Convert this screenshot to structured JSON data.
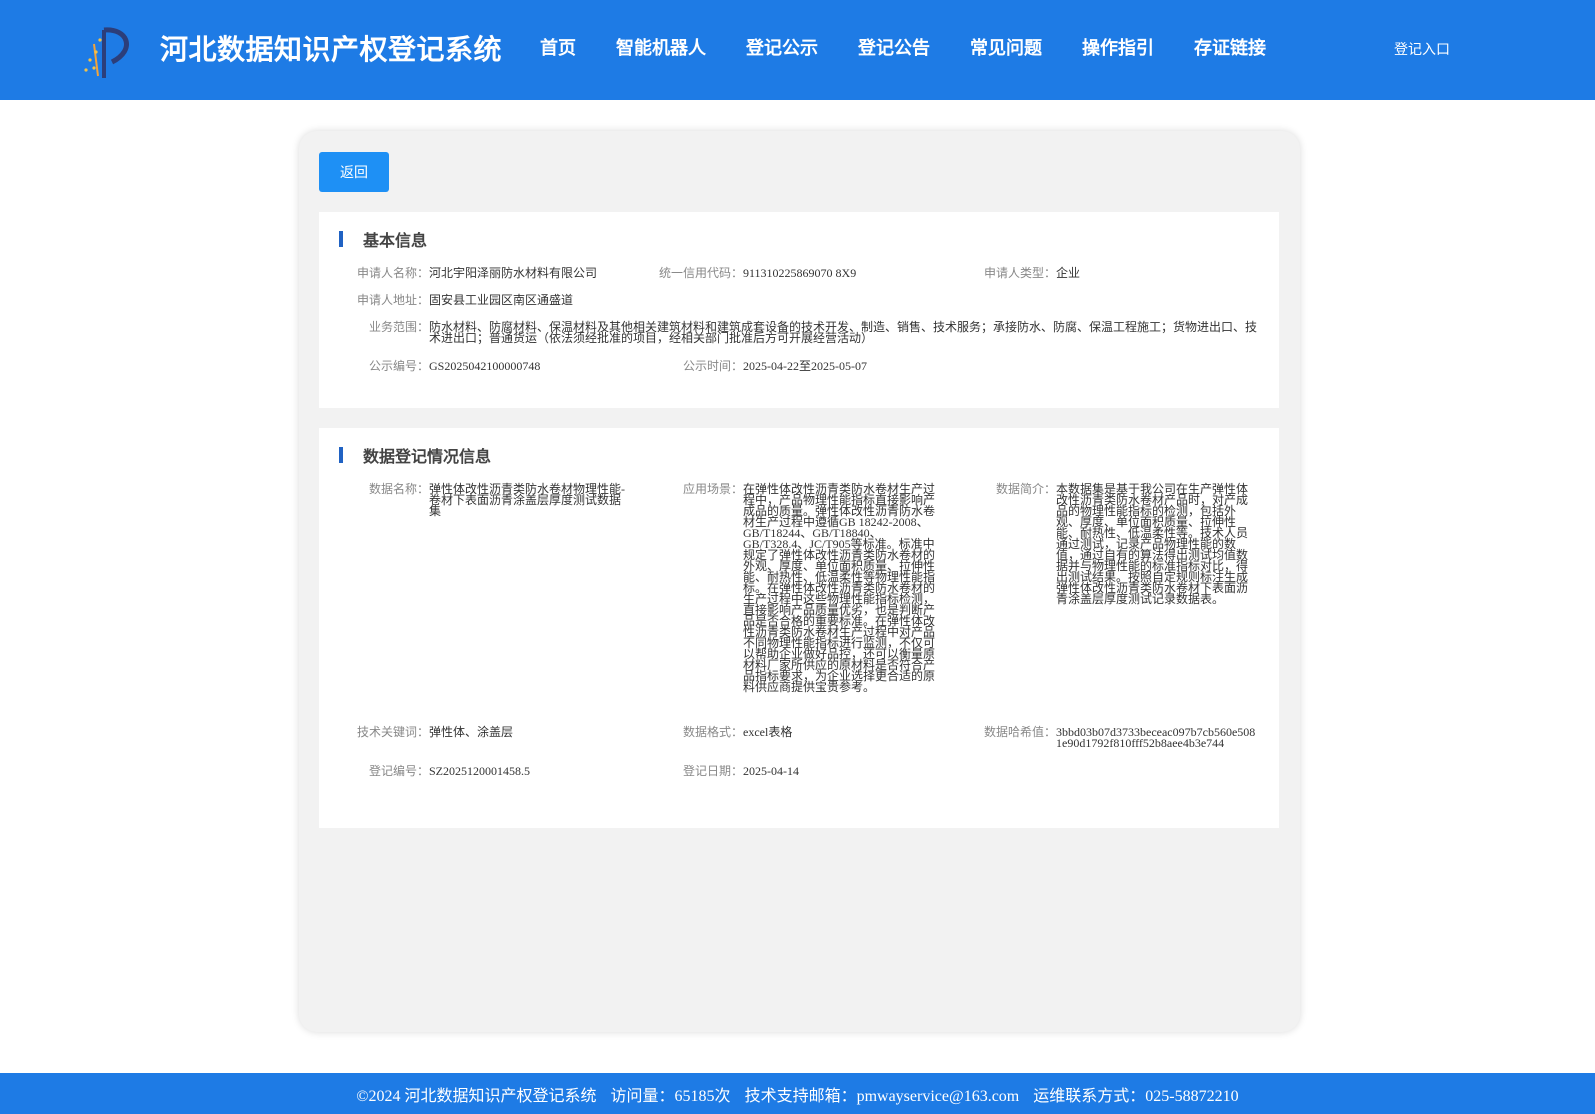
{
  "header": {
    "site_title": "河北数据知识产权登记系统",
    "nav": [
      "首页",
      "智能机器人",
      "登记公示",
      "登记公告",
      "常见问题",
      "操作指引",
      "存证链接"
    ],
    "login": "登记入口",
    "colors": {
      "bar": "#1e7be5",
      "accent": "#1e90f5"
    }
  },
  "back_button": "返回",
  "basic_info": {
    "title": "基本信息",
    "applicant_name": {
      "label": "申请人名称：",
      "value": "河北宇阳泽丽防水材料有限公司"
    },
    "credit_code": {
      "label": "统一信用代码：",
      "value": "911310225869070 8X9"
    },
    "applicant_type": {
      "label": "申请人类型：",
      "value": "企业"
    },
    "address": {
      "label": "申请人地址：",
      "value": "固安县工业园区南区通盛道"
    },
    "business_scope": {
      "label": "业务范围：",
      "value": "防水材料、防腐材料、保温材料及其他相关建筑材料和建筑成套设备的技术开发、制造、销售、技术服务；承接防水、防腐、保温工程施工；货物进出口、技术进出口；普通货运（依法须经批准的项目，经相关部门批准后方可开展经营活动）"
    },
    "notice_no": {
      "label": "公示编号：",
      "value": "GS2025042100000748"
    },
    "notice_time": {
      "label": "公示时间：",
      "value": "2025-04-22至2025-05-07"
    }
  },
  "registration_info": {
    "title": "数据登记情况信息",
    "data_name": {
      "label": "数据名称：",
      "value": "弹性体改性沥青类防水卷材物理性能-卷材下表面沥青涂盖层厚度测试数据集"
    },
    "scenario": {
      "label": "应用场景：",
      "value": "在弹性体改性沥青类防水卷材生产过程中，产品物理性能指标直接影响产成品的质量。弹性体改性沥青防水卷材生产过程中遵循GB 18242-2008、GB/T18244、GB/T18840、GB/T328.4、JC/T905等标准。标准中规定了弹性体改性沥青类防水卷材的外观、厚度、单位面积质量、拉伸性能、耐热性、低温柔性等物理性能指标。在弹性体改性沥青类防水卷材的生产过程中这些物理性能指标检测，直接影响产品质量优劣，也是判断产品是否合格的重要标准。在弹性体改性沥青类防水卷材生产过程中对产品不同物理性能指标进行监测，不仅可以帮助企业做好品控，还可以衡量原材料厂家所供应的原材料是否符合产品指标要求，为企业选择更合适的原料供应商提供宝贵参考。"
    },
    "intro": {
      "label": "数据简介：",
      "value": "本数据集是基于我公司在生产弹性体改性沥青类防水卷材产品时，对产成品的物理性能指标的检测，包括外观、厚度、单位面积质量、拉伸性能、耐热性、低温柔性等。技术人员通过测试，记录产品物理性能的数值，通过自有的算法得出测试均值数据并与物理性能的标准指标对比，得出测试结果。按照自定规则标注生成弹性体改性沥青类防水卷材下表面沥青涂盖层厚度测试记录数据表。"
    },
    "keywords": {
      "label": "技术关键词：",
      "value": "弹性体、涂盖层"
    },
    "format": {
      "label": "数据格式：",
      "value": "excel表格"
    },
    "hash": {
      "label": "数据哈希值：",
      "value": "3bbd03b07d3733beceac097b7cb560e5081e90d1792f810fff52b8aee4b3e744"
    },
    "reg_no": {
      "label": "登记编号：",
      "value": "SZ2025120001458.5"
    },
    "reg_date": {
      "label": "登记日期：",
      "value": "2025-04-14"
    }
  },
  "footer": {
    "copyright": "©2024 河北数据知识产权登记系统",
    "visits": "访问量：65185次",
    "email": "技术支持邮箱：pmwayservice@163.com",
    "phone": "运维联系方式：025-58872210"
  }
}
